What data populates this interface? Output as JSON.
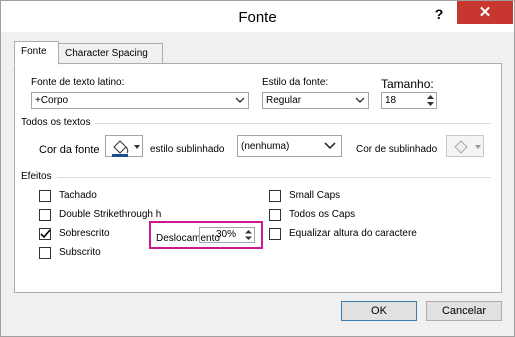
{
  "window": {
    "title": "Fonte",
    "help": "?",
    "close": "✕"
  },
  "tabs": [
    {
      "label": "Fonte"
    },
    {
      "label": "Character Spacing"
    }
  ],
  "font": {
    "latin_label": "Fonte de texto latino:",
    "latin_value": "+Corpo",
    "style_label": "Estilo da fonte:",
    "style_value": "Regular",
    "size_label": "Tamanho:",
    "size_value": "18"
  },
  "all_text": {
    "section": "Todos os textos",
    "font_color_label": "Cor da fonte",
    "underline_style_label": "estilo sublinhado",
    "underline_style_value": "(nenhuma)",
    "underline_color_label": "Cor de sublinhado"
  },
  "effects": {
    "section": "Efeitos",
    "strikethrough": "Tachado",
    "double_strikethrough": "Double Strikethrough h",
    "superscript": "Sobrescrito",
    "subscript": "Subscrito",
    "small_caps": "Small Caps",
    "all_caps": "Todos os Caps",
    "equalize": "Equalizar altura do caractere",
    "offset_label": "Deslocamento",
    "offset_value": "30%"
  },
  "buttons": {
    "ok": "OK",
    "cancel": "Cancelar"
  },
  "colors": {
    "highlight": "#cc1a8e",
    "close_red": "#c7372f"
  }
}
